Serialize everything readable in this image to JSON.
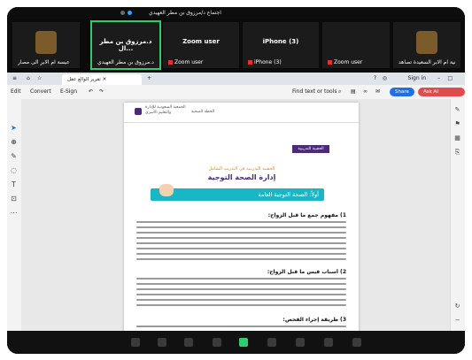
{
  "meeting": {
    "title": "اجتماع د/مرزوق بن مطر العهيدي",
    "tiles": [
      {
        "name": "عيسة ام الابر الى مصار",
        "center": ""
      },
      {
        "name": "د.مرزوق بن مطر العهيدي",
        "center": "د.مرزوق بن مطر ال...",
        "active": true
      },
      {
        "name": "Zoom user",
        "center": "Zoom user"
      },
      {
        "name": "iPhone (3)",
        "center": "iPhone (3)"
      },
      {
        "name": "Zoom user",
        "center": ""
      },
      {
        "name": "جمعية ام الابر السعيدة تصاهد",
        "center": ""
      }
    ]
  },
  "browser": {
    "tab_label": "تقرير الوالع عقل",
    "signin": "Sign in"
  },
  "toolbar": {
    "menu": [
      "Edit",
      "Convert",
      "E-Sign"
    ],
    "find": "Find text or tools",
    "share": "Share",
    "ask_ai": "Ask AI Assistant",
    "share_color": "#1f6feb",
    "ask_ai_color": "#e24b4b"
  },
  "document": {
    "org_line1": "الجمعية السعودية للإدارة",
    "org_line2": "والتعليم الأسري",
    "dept": "الخطة الصحية",
    "tag": "الحقيبة التدريبية",
    "subtitle": "الحقيبة التدريبية في التدريب الشامل",
    "title": "إدارة الصحة التوجية",
    "band": "أولاً: الصحة التوجية العامة",
    "sections": [
      "1) مفهوم جمع ما قبل الزواج:",
      "2) أسباب قيس ما قبل الزواج:",
      "3) طريقة إجراء الفحص:"
    ]
  }
}
